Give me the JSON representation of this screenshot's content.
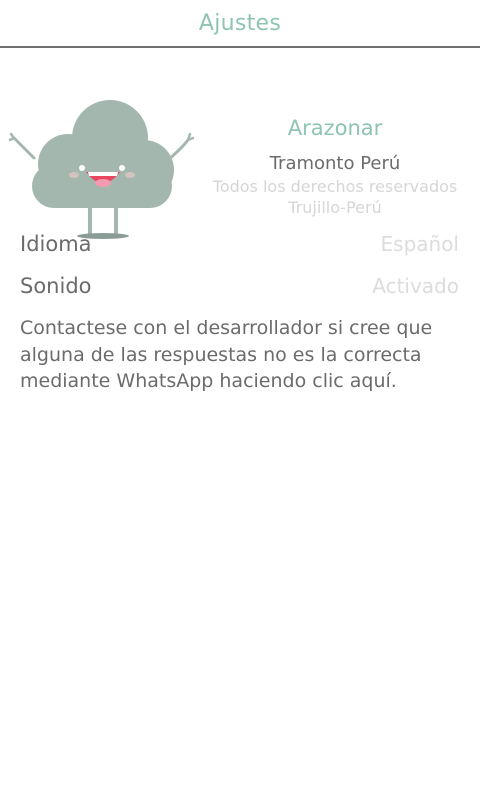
{
  "header": {
    "title": "Ajustes"
  },
  "about": {
    "app_name": "Arazonar",
    "company": "Tramonto Perú",
    "rights": "Todos los derechos reservados",
    "location": "Trujillo-Perú"
  },
  "settings": {
    "language_label": "Idioma",
    "language_value": "Español",
    "sound_label": "Sonido",
    "sound_value": "Activado"
  },
  "contact": {
    "text": "Contactese con el desarrollador si cree que alguna de las respuestas no es la correcta mediante WhatsApp haciendo clic aquí."
  },
  "colors": {
    "accent": "#8ec5b0",
    "text": "#6b6b6b",
    "muted": "#d6d6d6",
    "cloud": "#a3b7ae"
  }
}
